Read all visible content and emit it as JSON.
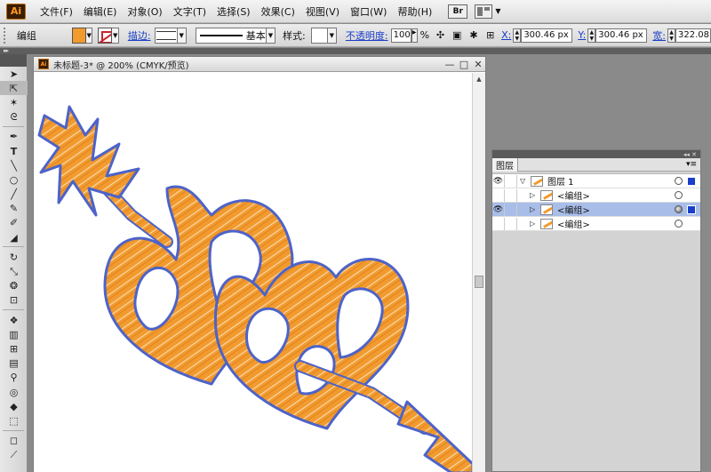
{
  "app": {
    "logo": "Ai"
  },
  "menu": {
    "items": [
      "文件(F)",
      "编辑(E)",
      "对象(O)",
      "文字(T)",
      "选择(S)",
      "效果(C)",
      "视图(V)",
      "窗口(W)",
      "帮助(H)"
    ],
    "bridge": "Br"
  },
  "control": {
    "selection": "编组",
    "stroke_label": "描边:",
    "profile": "基本",
    "style_label": "样式:",
    "opacity_label": "不透明度:",
    "opacity": "100",
    "pct": "%",
    "x_label": "X:",
    "x": "300.46 px",
    "y_label": "Y:",
    "y": "300.46 px",
    "w_label": "宽:",
    "w": "322.08"
  },
  "document": {
    "title": "未标题-3* @ 200% (CMYK/预览)",
    "artwork_icon": "heart-arrow-artwork"
  },
  "layers": {
    "tab": "图层",
    "rows": [
      {
        "name": "图层 1"
      },
      {
        "name": "<编组>"
      },
      {
        "name": "<编组>"
      },
      {
        "name": "<编组>"
      }
    ]
  },
  "colors": {
    "fill": "#f29a2e",
    "path": "#4d63c8",
    "selected_row": "#a8bde8"
  }
}
